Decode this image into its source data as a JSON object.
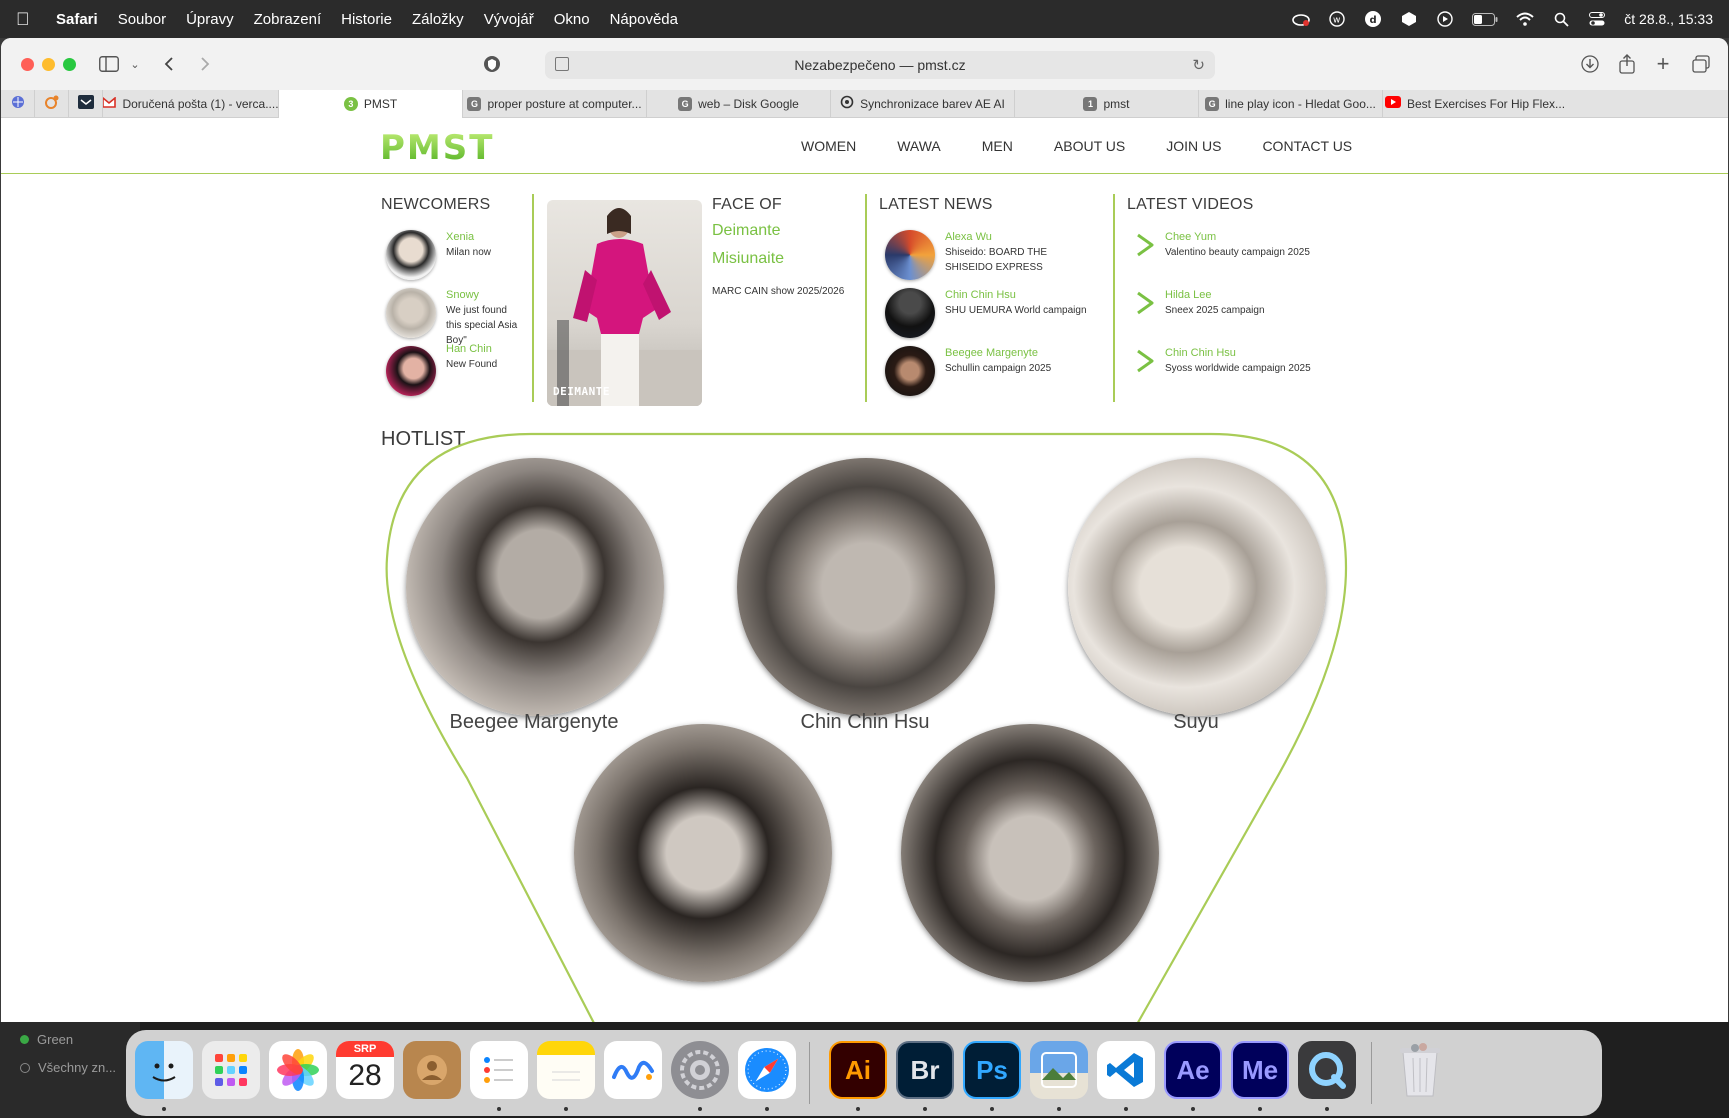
{
  "menubar": {
    "app": "Safari",
    "items": [
      "Soubor",
      "Úpravy",
      "Zobrazení",
      "Historie",
      "Záložky",
      "Vývojář",
      "Okno",
      "Nápověda"
    ],
    "datetime": "čt 28.8.,  15:33"
  },
  "browser": {
    "url_text": "Nezabezpečeno — pmst.cz",
    "tabs": [
      {
        "label": "Doručená pošta (1) - verca....",
        "icon": "gmail-icon"
      },
      {
        "label": "PMST",
        "icon": "pmst-icon",
        "active": true
      },
      {
        "label": "proper posture at computer...",
        "icon": "google-icon"
      },
      {
        "label": "web – Disk Google",
        "icon": "google-icon"
      },
      {
        "label": "Synchronizace barev AE AI",
        "icon": "openai-icon"
      },
      {
        "label": "pmst",
        "icon": "tab-number-icon",
        "badge": "1"
      },
      {
        "label": "line play icon - Hledat Goo...",
        "icon": "google-icon"
      },
      {
        "label": "Best Exercises For Hip Flex...",
        "icon": "youtube-icon"
      }
    ]
  },
  "site": {
    "logo": "PMST",
    "nav": [
      "WOMEN",
      "WAWA",
      "MEN",
      "ABOUT US",
      "JOIN US",
      "CONTACT US"
    ],
    "newcomers": {
      "title": "NEWCOMERS",
      "items": [
        {
          "name": "Xenia",
          "desc": "Milan now"
        },
        {
          "name": "Snowy",
          "desc": "We just found this special Asia Boy\""
        },
        {
          "name": "Han Chin",
          "desc": "New Found"
        }
      ]
    },
    "face_of": {
      "title": "FACE OF",
      "first_name": "Deimante",
      "last_name": "Misiunaite",
      "desc": "MARC CAIN show 2025/2026",
      "photo_caption": "DEIMANTE"
    },
    "news": {
      "title": "LATEST NEWS",
      "items": [
        {
          "name": "Alexa Wu",
          "desc": "Shiseido: BOARD THE SHISEIDO EXPRESS"
        },
        {
          "name": "Chin Chin Hsu",
          "desc": "SHU UEMURA World campaign"
        },
        {
          "name": "Beegee Margenyte",
          "desc": "Schullin campaign 2025"
        }
      ]
    },
    "videos": {
      "title": "LATEST VIDEOS",
      "items": [
        {
          "name": "Chee Yum",
          "desc": "Valentino beauty campaign 2025"
        },
        {
          "name": "Hilda Lee",
          "desc": "Sneex 2025 campaign"
        },
        {
          "name": "Chin Chin Hsu",
          "desc": "Syoss worldwide campaign 2025"
        }
      ]
    },
    "hotlist": {
      "title": "HOTLIST",
      "models": [
        "Beegee Margenyte",
        "Chin Chin Hsu",
        "Suyu"
      ]
    }
  },
  "finder_sidebar": {
    "tag": "Green",
    "all": "Všechny zn..."
  },
  "dock": {
    "calendar_month": "SRP",
    "calendar_day": "28",
    "apps": [
      "Finder",
      "Launchpad",
      "Photos",
      "Calendar",
      "Contacts",
      "Reminders",
      "Notes",
      "Freeform",
      "System Settings",
      "Safari",
      "Ai",
      "Br",
      "Ps",
      "Preview",
      "VS Code",
      "Ae",
      "Me",
      "QuickTime",
      "Trash"
    ]
  },
  "colors": {
    "accent_green": "#7ac143",
    "line_green": "#a9cc57"
  }
}
